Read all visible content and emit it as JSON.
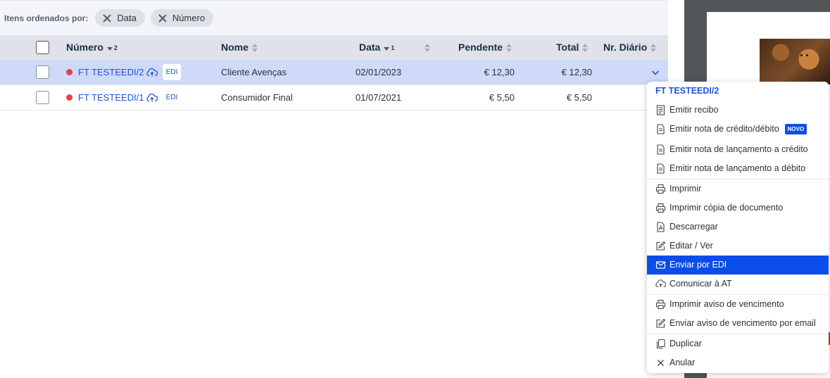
{
  "filters": {
    "label": "Itens ordenados por:",
    "chips": [
      "Data",
      "Número"
    ]
  },
  "table": {
    "columns": {
      "numero": "Número",
      "numero_order": "2",
      "nome": "Nome",
      "data": "Data",
      "data_order": "1",
      "pendente": "Pendente",
      "total": "Total",
      "diario": "Nr. Diário"
    },
    "rows": [
      {
        "numero": "FT TESTEEDI/2",
        "edi": "EDI",
        "nome": "Cliente Avenças",
        "data": "02/01/2023",
        "pendente": "€ 12,30",
        "total": "€ 12,30"
      },
      {
        "numero": "FT TESTEEDI/1",
        "edi": "EDI",
        "nome": "Consumidor Final",
        "data": "01/07/2021",
        "pendente": "€ 5,50",
        "total": "€ 5,50"
      }
    ]
  },
  "menu": {
    "title": "FT TESTEEDI/2",
    "items": [
      {
        "label": "Emitir recibo",
        "icon": "receipt-icon"
      },
      {
        "label": "Emitir nota de crédito/débito",
        "icon": "document-icon",
        "badge": "NOVO"
      },
      {
        "label": "Emitir nota de lançamento a crédito",
        "icon": "document-icon"
      },
      {
        "label": "Emitir nota de lançamento a débito",
        "icon": "document-icon"
      },
      {
        "label": "Imprimir",
        "icon": "printer-icon"
      },
      {
        "label": "Imprimir cópia de documento",
        "icon": "printer-icon"
      },
      {
        "label": "Descarregar",
        "icon": "pdf-icon"
      },
      {
        "label": "Editar / Ver",
        "icon": "edit-icon"
      },
      {
        "label": "Enviar por EDI",
        "icon": "envelope-icon"
      },
      {
        "label": "Comunicar à AT",
        "icon": "cloud-upload-icon"
      },
      {
        "label": "Imprimir aviso de vencimento",
        "icon": "printer-icon"
      },
      {
        "label": "Enviar aviso de vencimento por email",
        "icon": "edit-icon"
      },
      {
        "label": "Duplicar",
        "icon": "copy-icon"
      },
      {
        "label": "Anular",
        "icon": "close-icon"
      }
    ]
  },
  "colors": {
    "accent": "#1a56d6",
    "menu_active": "#0a4de8",
    "selected_row": "#cfdaf8",
    "status_dot": "#e6404c"
  }
}
